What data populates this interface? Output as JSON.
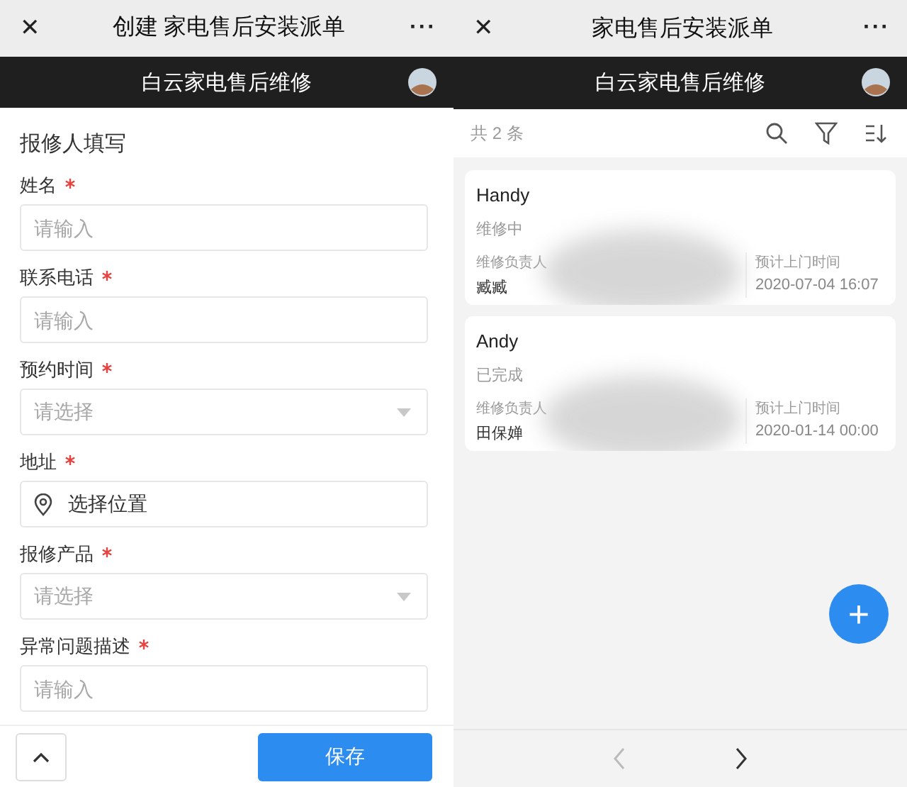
{
  "left": {
    "window": {
      "close": "✕",
      "title": "创建 家电售后安装派单",
      "more": "···"
    },
    "app_bar": {
      "title": "白云家电售后维修"
    },
    "section": "报修人填写",
    "fields": [
      {
        "label": "姓名",
        "required": true,
        "kind": "input",
        "placeholder": "请输入"
      },
      {
        "label": "联系电话",
        "required": true,
        "kind": "input",
        "placeholder": "请输入"
      },
      {
        "label": "预约时间",
        "required": true,
        "kind": "select",
        "placeholder": "请选择"
      },
      {
        "label": "地址",
        "required": true,
        "kind": "location",
        "value": "选择位置"
      },
      {
        "label": "报修产品",
        "required": true,
        "kind": "select",
        "placeholder": "请选择"
      },
      {
        "label": "异常问题描述",
        "required": true,
        "kind": "input",
        "placeholder": "请输入"
      }
    ],
    "save_button": "保存"
  },
  "right": {
    "window": {
      "close": "✕",
      "title": "家电售后安装派单",
      "more": "···"
    },
    "app_bar": {
      "title": "白云家电售后维修"
    },
    "count": "共 2 条",
    "records": [
      {
        "name": "Handy",
        "status": "维修中",
        "owner_label": "维修负责人",
        "owner": "臧臧",
        "time_label": "预计上门时间",
        "time": "2020-07-04 16:07"
      },
      {
        "name": "Andy",
        "status": "已完成",
        "owner_label": "维修负责人",
        "owner": "田保婵",
        "time_label": "预计上门时间",
        "time": "2020-01-14 00:00"
      }
    ],
    "fab": "+",
    "pager": {
      "prev_disabled": true,
      "next_disabled": false
    }
  }
}
